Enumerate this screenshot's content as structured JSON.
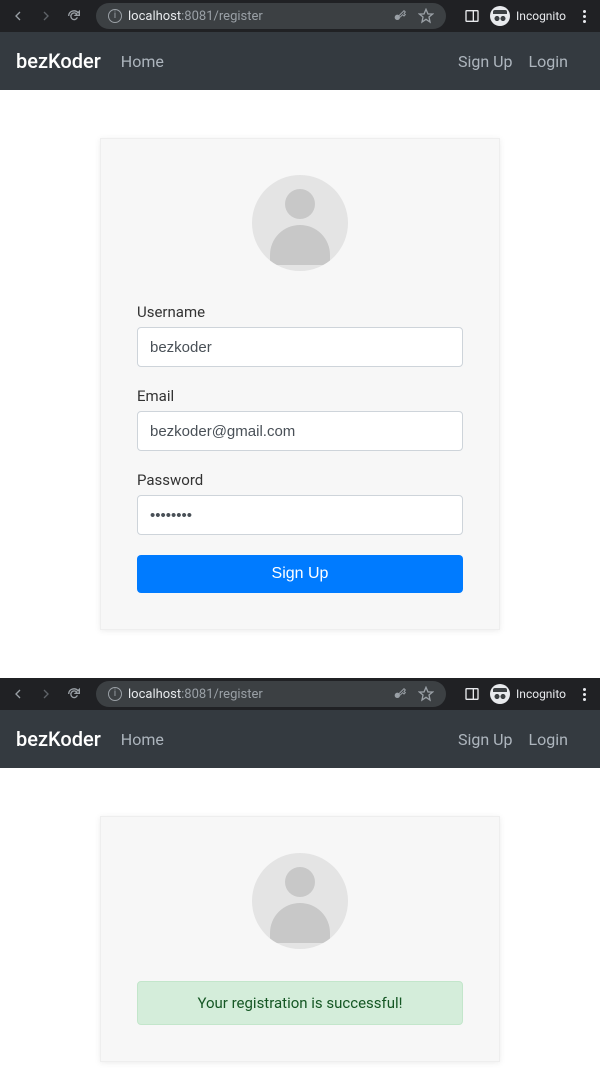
{
  "browser": {
    "url_host": "localhost",
    "url_port": ":8081",
    "url_path": "/register",
    "incognito_label": "Incognito"
  },
  "navbar": {
    "brand": "bezKoder",
    "home": "Home",
    "signup": "Sign Up",
    "login": "Login"
  },
  "form": {
    "username_label": "Username",
    "username_value": "bezkoder",
    "email_label": "Email",
    "email_value": "bezkoder@gmail.com",
    "password_label": "Password",
    "password_value": "••••••••",
    "submit_label": "Sign Up"
  },
  "success": {
    "message": "Your registration is successful!"
  }
}
